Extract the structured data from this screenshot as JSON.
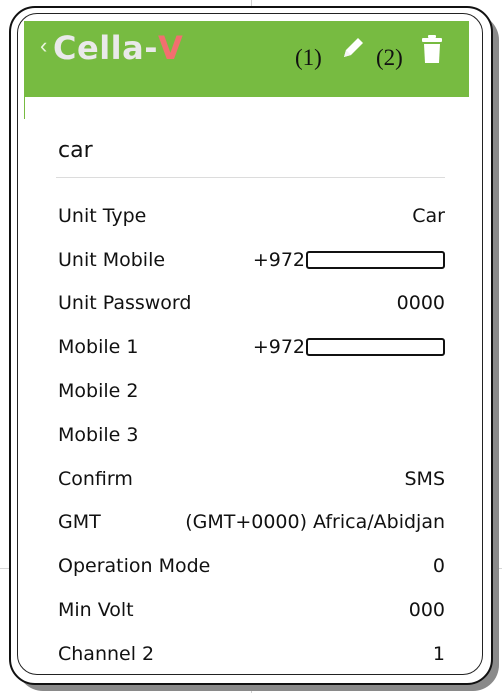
{
  "header": {
    "back_icon": "chevron-left-icon",
    "logo": {
      "prefix": "Cella-",
      "suffix": "V"
    },
    "callout_1": "(1)",
    "callout_2": "(2)",
    "edit_icon": "pencil-icon",
    "delete_icon": "trash-icon",
    "bar_color": "#77bb41"
  },
  "unit": {
    "name": "car"
  },
  "fields": [
    {
      "label": "Unit Type",
      "value": "Car"
    },
    {
      "label": "Unit Mobile",
      "value": "+972"
    },
    {
      "label": "Unit Password",
      "value": "0000"
    },
    {
      "label": "Mobile 1",
      "value": "+972"
    },
    {
      "label": "Mobile 2",
      "value": ""
    },
    {
      "label": "Mobile 3",
      "value": ""
    },
    {
      "label": "Confirm",
      "value": "SMS"
    },
    {
      "label": "GMT",
      "value": "(GMT+0000) Africa/Abidjan"
    },
    {
      "label": "Operation Mode",
      "value": "0"
    },
    {
      "label": "Min Volt",
      "value": "000"
    },
    {
      "label": "Channel 2",
      "value": "1"
    }
  ]
}
